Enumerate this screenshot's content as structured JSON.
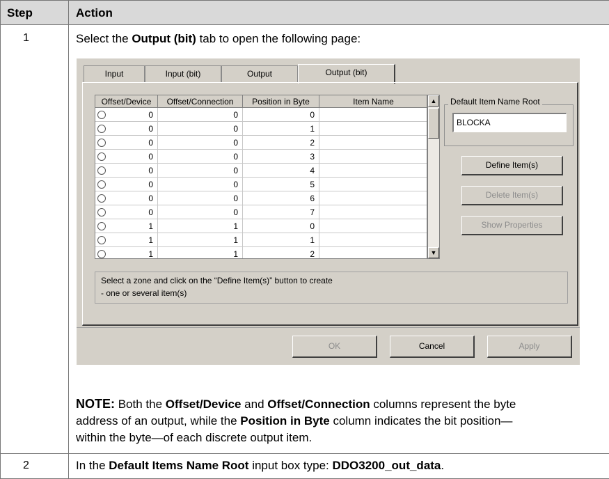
{
  "table": {
    "headers": {
      "step": "Step",
      "action": "Action"
    },
    "rows": [
      {
        "step": "1",
        "intro": {
          "pre": "Select the ",
          "bold": "Output (bit)",
          "post": " tab to open the following page:"
        },
        "note": {
          "label": "NOTE:",
          "t1": " Both the ",
          "b1": "Offset/Device",
          "t2": " and ",
          "b2": "Offset/Connection",
          "t3": " columns represent the byte",
          "line2_pre": "address of an output, while the ",
          "b3": "Position in Byte",
          "line2_post": " column indicates the bit position—",
          "line3": "within the byte—of each discrete output item."
        }
      },
      {
        "step": "2",
        "pre": "In the ",
        "bold1": "Default Items Name Root",
        "mid": " input box type: ",
        "bold2": "DDO3200_out_data",
        "post": "."
      }
    ]
  },
  "dialog": {
    "tabs": [
      "Input",
      "Input (bit)",
      "Output",
      "Output (bit)"
    ],
    "active_tab": "Output (bit)",
    "grid": {
      "columns": [
        "Offset/Device",
        "Offset/Connection",
        "Position in Byte",
        "Item Name"
      ],
      "rows": [
        [
          "0",
          "0",
          "0",
          ""
        ],
        [
          "0",
          "0",
          "1",
          ""
        ],
        [
          "0",
          "0",
          "2",
          ""
        ],
        [
          "0",
          "0",
          "3",
          ""
        ],
        [
          "0",
          "0",
          "4",
          ""
        ],
        [
          "0",
          "0",
          "5",
          ""
        ],
        [
          "0",
          "0",
          "6",
          ""
        ],
        [
          "0",
          "0",
          "7",
          ""
        ],
        [
          "1",
          "1",
          "0",
          ""
        ],
        [
          "1",
          "1",
          "1",
          ""
        ],
        [
          "1",
          "1",
          "2",
          ""
        ]
      ]
    },
    "default_root": {
      "label": "Default Item Name Root",
      "value": "BLOCKA"
    },
    "buttons": {
      "define": "Define Item(s)",
      "delete": "Delete Item(s)",
      "properties": "Show Properties",
      "ok": "OK",
      "cancel": "Cancel",
      "apply": "Apply"
    },
    "hint": {
      "line1": "Select a zone and click on the “Define Item(s)” button to create",
      "line2": "- one or several item(s)"
    }
  }
}
